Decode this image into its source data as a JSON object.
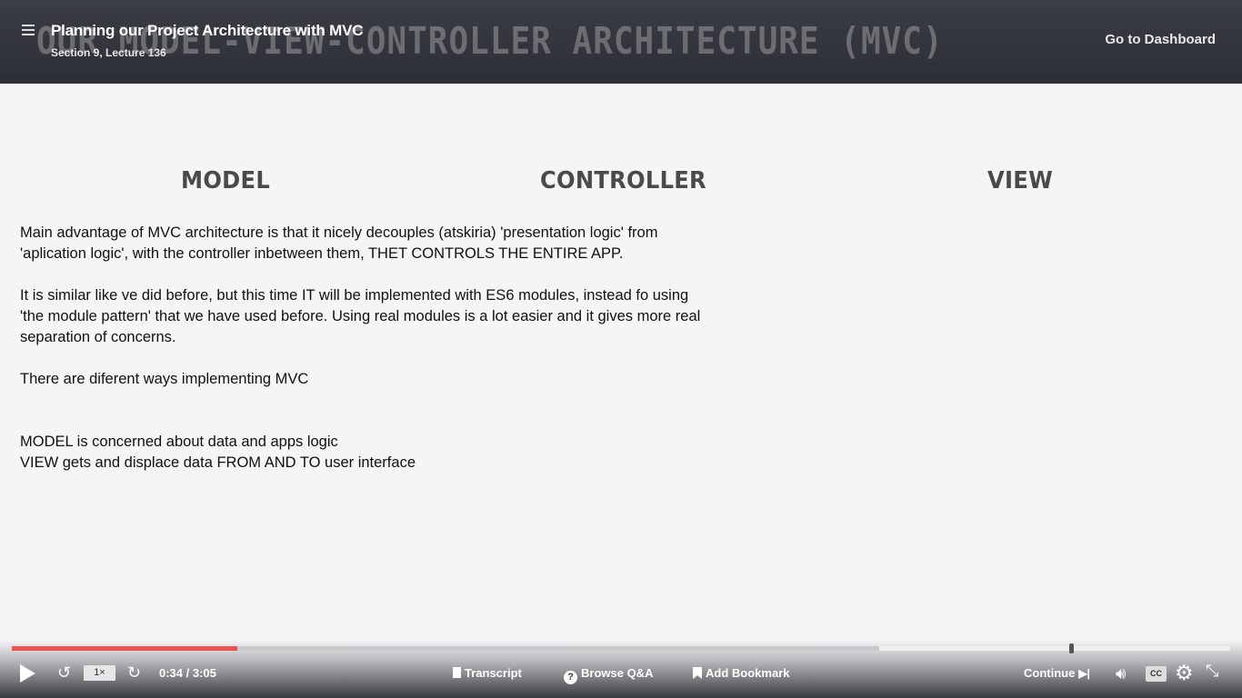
{
  "header": {
    "background_title": "OUR MODEL-VIEW-CONTROLLER ARCHITECTURE (MVC)",
    "lecture_title": "Planning our Project Architecture with MVC",
    "lecture_subtitle": "Section 9, Lecture 136",
    "dashboard_link": "Go to Dashboard"
  },
  "slide": {
    "headings": [
      "MODEL",
      "CONTROLLER",
      "VIEW"
    ],
    "notes": [
      "Main advantage of MVC architecture is that it nicely decouples (atskiria) 'presentation logic' from",
      "'aplication logic', with the controller inbetween them, THET CONTROLS THE ENTIRE APP.",
      "It is similar like ve did before, but this time IT will be implemented with ES6 modules, instead fo using",
      "'the module pattern' that we have used before. Using real modules is a lot easier and it gives more real",
      "separation of concerns.",
      "There are diferent ways implementing MVC",
      "MODEL is concerned about data and apps logic",
      "VIEW gets and displace data FROM AND TO user interface"
    ]
  },
  "player": {
    "progress_fraction": 0.185,
    "speed": "1×",
    "time": "0:34 / 3:05",
    "transcript_label": "Transcript",
    "qa_label": "Browse Q&A",
    "bookmark_label": "Add Bookmark",
    "continue_label": "Continue",
    "cc_label": "CC",
    "accent_color": "#ec5252"
  }
}
